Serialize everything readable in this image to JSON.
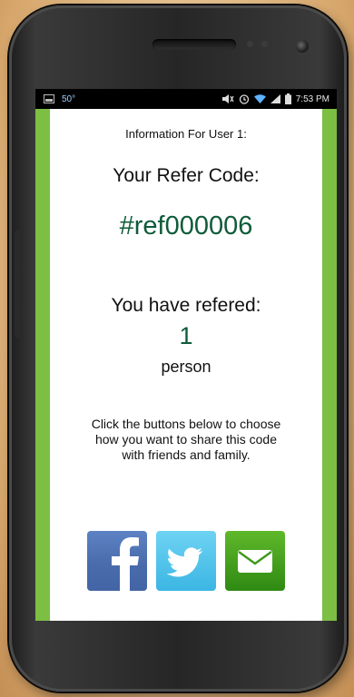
{
  "status_bar": {
    "temperature": "50°",
    "time": "7:53 PM"
  },
  "screen": {
    "info_title": "Information For User 1:",
    "refer_label": "Your Refer Code:",
    "refer_code": "#ref000006",
    "referred_label": "You have refered:",
    "referred_count": "1",
    "referred_unit": "person",
    "instructions": "Click the buttons below to choose how you want to share this code with friends and family."
  },
  "share_buttons": [
    {
      "name": "facebook",
      "icon": "facebook-icon"
    },
    {
      "name": "twitter",
      "icon": "twitter-bird-icon"
    },
    {
      "name": "email",
      "icon": "envelope-icon"
    }
  ],
  "colors": {
    "accent_green": "#7cbf43",
    "code_green": "#0f5b3a"
  }
}
